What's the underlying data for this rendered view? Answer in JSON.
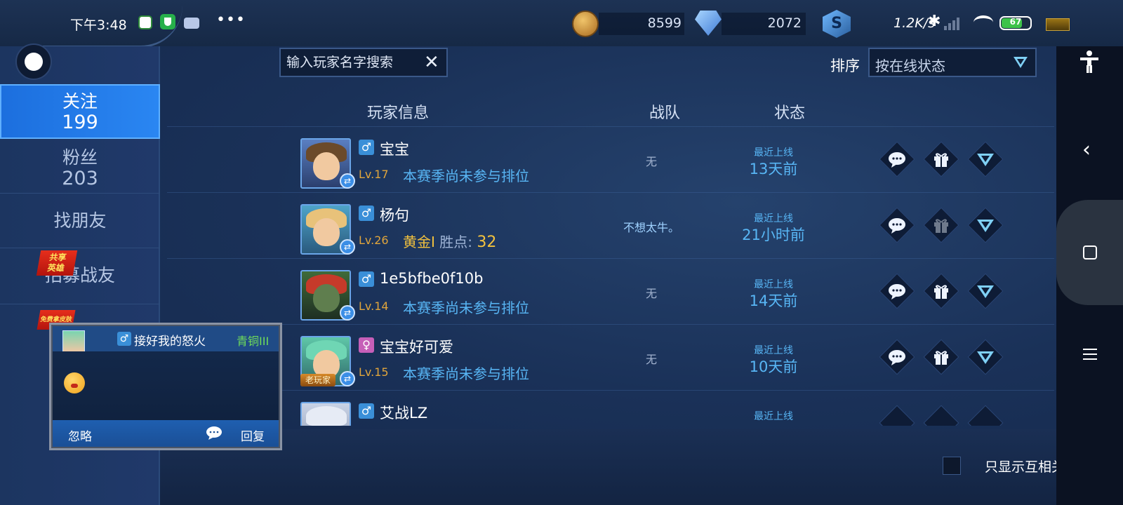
{
  "status_bar": {
    "time": "下午3:48",
    "more": "•••",
    "gold": "8599",
    "diamonds": "2072",
    "net_speed": "1.2K/s",
    "battery": "67"
  },
  "sidebar": {
    "tabs": [
      {
        "label": "关注",
        "count": "199"
      },
      {
        "label": "粉丝",
        "count": "203"
      },
      {
        "label": "找朋友"
      },
      {
        "label": "招募战友"
      }
    ],
    "share_badge": "共享\n英雄",
    "free_badge": "免费拿皮肤"
  },
  "search": {
    "placeholder": "输入玩家名字搜索",
    "clear": "✕"
  },
  "sort": {
    "label": "排序",
    "value": "按在线状态"
  },
  "table": {
    "headers": {
      "player": "玩家信息",
      "team": "战队",
      "status": "状态"
    }
  },
  "friends": [
    {
      "name": "宝宝",
      "gender": "male",
      "level": "Lv.17",
      "rank": "本赛季尚未参与排位",
      "team": "无",
      "status_label": "最近上线",
      "status_time": "13天前"
    },
    {
      "name": "杨句",
      "gender": "male",
      "level": "Lv.26",
      "rank_tier": "黄金I",
      "rank_points_label": "胜点:",
      "rank_points": "32",
      "team": "不想太牛。",
      "status_label": "最近上线",
      "status_time": "21小时前"
    },
    {
      "name": "1e5bfbe0f10b",
      "gender": "male",
      "level": "Lv.14",
      "rank": "本赛季尚未参与排位",
      "team": "无",
      "status_label": "最近上线",
      "status_time": "14天前"
    },
    {
      "name": "宝宝好可爱",
      "gender": "female",
      "level": "Lv.15",
      "rank": "本赛季尚未参与排位",
      "team": "无",
      "status_label": "最近上线",
      "status_time": "10天前",
      "badge": "老玩家"
    },
    {
      "name": "艾战LZ",
      "gender": "male",
      "status_label": "最近上线"
    }
  ],
  "chat_popup": {
    "sender": "接好我的怒火",
    "rank": "青铜III",
    "ignore": "忽略",
    "reply": "回复"
  },
  "filter": {
    "mutual_only": "只显示互相关注"
  },
  "colors": {
    "accent_blue": "#2a86f2",
    "status_blue": "#58b6f5",
    "gold": "#f2c13e",
    "level_orange": "#e0a53c",
    "bronze_green": "#6fdc5a"
  }
}
